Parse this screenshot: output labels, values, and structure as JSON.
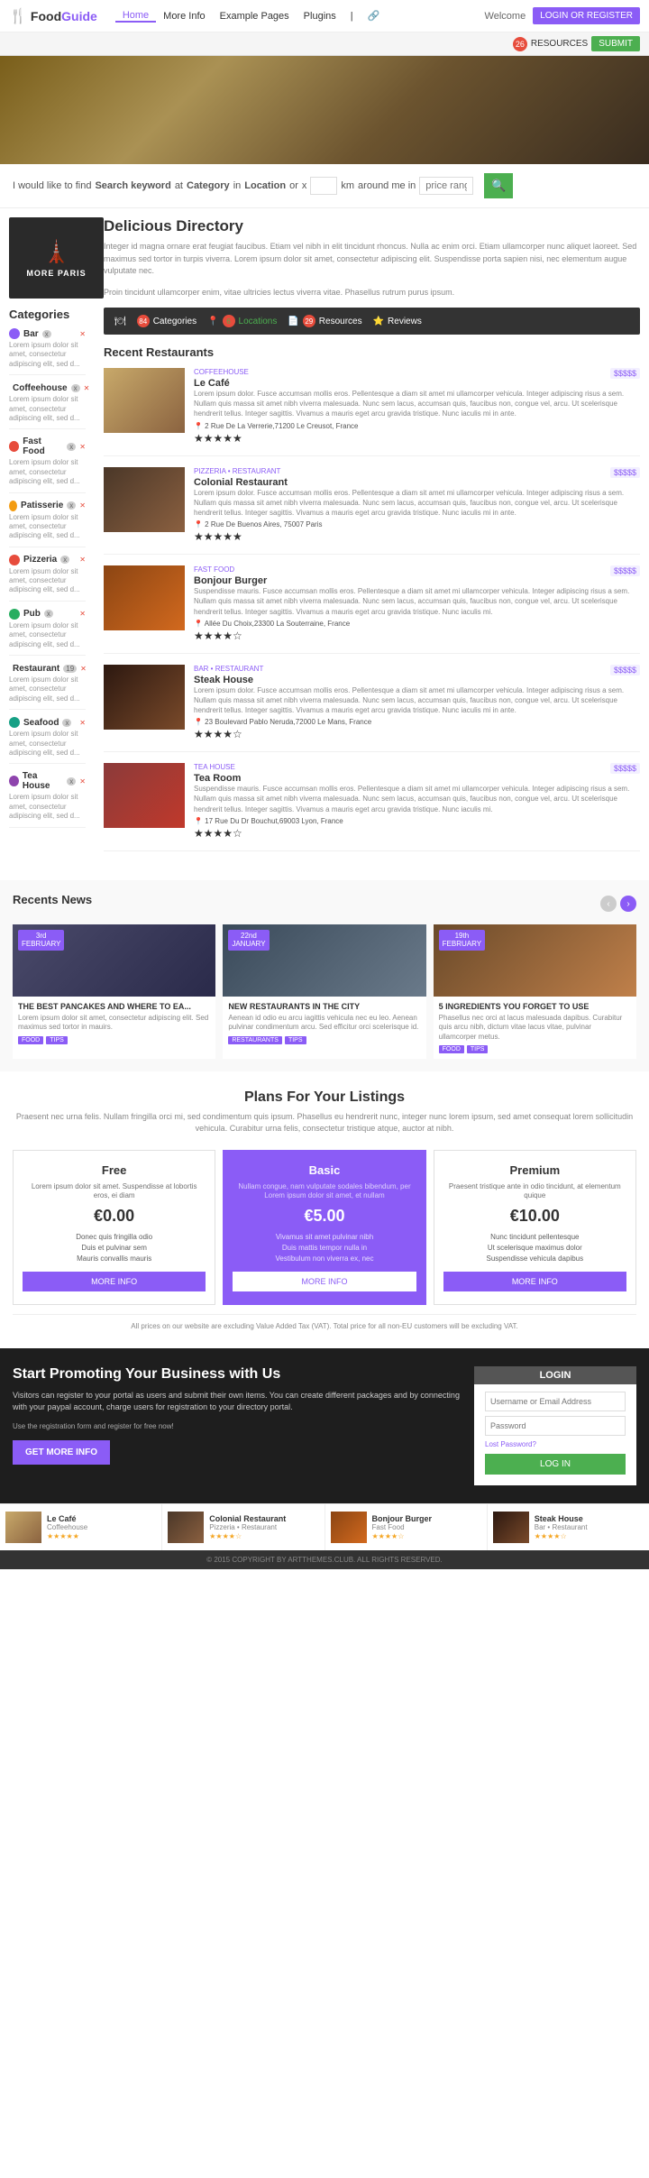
{
  "navbar": {
    "logo_icon": "🍴",
    "logo_text_plain": "Food",
    "logo_text_accent": "Guide",
    "links": [
      "Home",
      "More Info",
      "Example Pages",
      "Plugins",
      "|",
      "🔗"
    ],
    "welcome": "Welcome",
    "login_btn": "LOGIN OR REGISTER"
  },
  "topbar": {
    "badge_count": "26",
    "resources_label": "RESOURCES",
    "submit_label": "SUBMIT"
  },
  "search": {
    "prefix": "I would like to find",
    "keyword_link": "Search keyword",
    "at_label": "at",
    "category_label": "Category",
    "in_label": "in",
    "location_link": "Location",
    "or_label": "or",
    "x_label": "x",
    "km_label": "km",
    "around_me_label": "around me in",
    "price_label": "price range",
    "search_icon": "🔍"
  },
  "featured": {
    "icon": "🗼",
    "label": "MORE PARIS"
  },
  "sidebar": {
    "title": "Categories",
    "items": [
      {
        "name": "Bar",
        "count": "x",
        "color": "cat-bar",
        "desc": "Lorem ipsum dolor sit amet, consectetur adipiscing elit, sed d..."
      },
      {
        "name": "Coffeehouse",
        "count": "x",
        "color": "cat-coffee",
        "desc": "Lorem ipsum dolor sit amet, consectetur adipiscing elit, sed d..."
      },
      {
        "name": "Fast Food",
        "count": "x",
        "color": "cat-fast",
        "desc": "Lorem ipsum dolor sit amet, consectetur adipiscing elit, sed d..."
      },
      {
        "name": "Patisserie",
        "count": "x",
        "color": "cat-patisserie",
        "desc": "Lorem ipsum dolor sit amet, consectetur adipiscing elit, sed d..."
      },
      {
        "name": "Pizzeria",
        "count": "x",
        "color": "cat-pizzeria",
        "desc": "Lorem ipsum dolor sit amet, consectetur adipiscing elit, sed d..."
      },
      {
        "name": "Pub",
        "count": "x",
        "color": "cat-pub",
        "desc": "Lorem ipsum dolor sit amet, consectetur adipiscing elit, sed d..."
      },
      {
        "name": "Restaurant",
        "count": "19",
        "color": "cat-restaurant",
        "desc": "Lorem ipsum dolor sit amet, consectetur adipiscing elit, sed d..."
      },
      {
        "name": "Seafood",
        "count": "x",
        "color": "cat-seafood",
        "desc": "Lorem ipsum dolor sit amet, consectetur adipiscing elit, sed d..."
      },
      {
        "name": "Tea House",
        "count": "x",
        "color": "cat-tea",
        "desc": "Lorem ipsum dolor sit amet, consectetur adipiscing elit, sed d..."
      }
    ]
  },
  "directory": {
    "title": "Delicious Directory",
    "desc1": "Integer id magna ornare erat feugiat faucibus. Etiam vel nibh in elit tincidunt rhoncus. Nulla ac enim orci. Etiam ullamcorper nunc aliquet laoreet. Sed maximus sed tortor in turpis viverra. Lorem ipsum dolor sit amet, consectetur adipiscing elit. Suspendisse porta sapien nisi, nec elementum augue vulputate nec.",
    "desc2": "Proin tincidunt ullamcorper enim, vitae ultricies lectus viverra vitae. Phasellus rutrum purus ipsum."
  },
  "stats_bar": {
    "items": [
      {
        "icon": "🍽",
        "label": "84 Categories"
      },
      {
        "icon": "📍",
        "label": "6 Locations"
      },
      {
        "icon": "📄",
        "label": "29 Resources"
      },
      {
        "icon": "⭐",
        "label": "Reviews"
      }
    ]
  },
  "restaurants": {
    "section_title": "Recent Restaurants",
    "items": [
      {
        "name": "Le Café",
        "category": "COFFEEHOUSE",
        "price": "$$$$$",
        "desc": "Lorem ipsum dolor. Fusce accumsan mollis eros. Pellentesque a diam sit amet mi ullamcorper vehicula. Integer adipiscing risus a sem. Nullam quis massa sit amet nibh viverra malesuada. Nunc sem lacus, accumsan quis, faucibus non, congue vel, arcu. Ut scelerisque hendrerit tellus. Integer sagittis. Vivamus a mauris eget arcu gravida tristique. Nunc iaculis mi in ante.",
        "address": "2 Rue De La Verrerie,71200 Le Creusot, France",
        "img_class": "img-le-cafe",
        "stars": 5
      },
      {
        "name": "Colonial Restaurant",
        "category": "PIZZERIA • RESTAURANT",
        "price": "$$$$$",
        "desc": "Lorem ipsum dolor. Fusce accumsan mollis eros. Pellentesque a diam sit amet mi ullamcorper vehicula. Integer adipiscing risus a sem. Nullam quis massa sit amet nibh viverra malesuada. Nunc sem lacus, accumsan quis, faucibus non, congue vel, arcu. Ut scelerisque hendrerit tellus. Integer sagittis. Vivamus a mauris eget arcu gravida tristique. Nunc iaculis mi in ante.",
        "address": "2 Rue De Buenos Aires, 75007 Paris",
        "img_class": "img-colonial",
        "stars": 5
      },
      {
        "name": "Bonjour Burger",
        "category": "FAST FOOD",
        "price": "$$$$$",
        "desc": "Suspendisse mauris. Fusce accumsan mollis eros. Pellentesque a diam sit amet mi ullamcorper vehicula. Integer adipiscing risus a sem. Nullam quis massa sit amet nibh viverra malesuada. Nunc sem lacus, accumsan quis, faucibus non, congue vel, arcu. Ut scelerisque hendrerit tellus. Integer sagittis. Vivamus a mauris eget arcu gravida tristique. Nunc iaculis mi.",
        "address": "Allée Du Choix,23300 La Souterraine, France",
        "img_class": "img-burger",
        "stars": 4
      },
      {
        "name": "Steak House",
        "category": "BAR • RESTAURANT",
        "price": "$$$$$",
        "desc": "Lorem ipsum dolor. Fusce accumsan mollis eros. Pellentesque a diam sit amet mi ullamcorper vehicula. Integer adipiscing risus a sem. Nullam quis massa sit amet nibh viverra malesuada. Nunc sem lacus, accumsan quis, faucibus non, congue vel, arcu. Ut scelerisque hendrerit tellus. Integer sagittis. Vivamus a mauris eget arcu gravida tristique. Nunc iaculis mi in ante.",
        "address": "23 Boulevard Pablo Neruda,72000 Le Mans, France",
        "img_class": "img-steak",
        "stars": 4
      },
      {
        "name": "Tea Room",
        "category": "TEA HOUSE",
        "price": "$$$$$",
        "desc": "Suspendisse mauris. Fusce accumsan mollis eros. Pellentesque a diam sit amet mi ullamcorper vehicula. Integer adipiscing risus a sem. Nullam quis massa sit amet nibh viverra malesuada. Nunc sem lacus, accumsan quis, faucibus non, congue vel, arcu. Ut scelerisque hendrerit tellus. Integer sagittis. Vivamus a mauris eget arcu gravida tristique. Nunc iaculis mi.",
        "address": "17 Rue Du Dr Bouchut,69003 Lyon, France",
        "img_class": "img-tea",
        "stars": 4
      }
    ]
  },
  "news": {
    "section_title": "Recents News",
    "items": [
      {
        "date_day": "3rd",
        "date_month": "FEBRUARY",
        "title": "THE BEST PANCAKES AND WHERE TO EA...",
        "desc": "Lorem ipsum dolor sit amet, consectetur adipiscing elit. Sed maximus sed tortor in mauirs.",
        "tags": [
          "FOOD",
          "TIPS"
        ],
        "img_class": "img-news1"
      },
      {
        "date_day": "22nd",
        "date_month": "JANUARY",
        "title": "NEW RESTAURANTS IN THE CITY",
        "desc": "Aenean id odio eu arcu iagittis vehicula nec eu leo. Aenean pulvinar condimentum arcu. Sed efficitur orci scelerisque id. Duis aliquet vitae ipsum viae.",
        "tags": [
          "RESTAURANTS",
          "TIPS"
        ],
        "img_class": "img-news2"
      },
      {
        "date_day": "19th",
        "date_month": "FEBRUARY",
        "title": "5 INGREDIENTS YOU FORGET TO USE",
        "desc": "Phasellus nec orci at lacus malesuada dapibus. Curabitur quis arcu nibh, dictum vitae lacus vitae, pulvinar ullamcorper metus. Praesent efficitur.",
        "tags": [
          "FOOD",
          "TIPS"
        ],
        "img_class": "img-news3"
      }
    ]
  },
  "plans": {
    "section_title": "Plans For Your Listings",
    "desc": "Praesent nec urna felis. Nullam fringilla orci mi, sed condimentum quis ipsum. Phasellus eu hendrerit nunc, integer nunc lorem ipsum, sed amet consequat lorem sollicitudin vehicula. Curabitur urna felis, consectetur tristique atque, auctor at nibh.",
    "items": [
      {
        "name": "Free",
        "desc": "Lorem ipsum dolor sit amet. Suspendisse at lobortis eros, ei diam",
        "price": "€0.00",
        "features": [
          "Donec quis fringilla odio",
          "Duis et pulvinar sem",
          "Mauris convallis mauris"
        ],
        "btn": "MORE INFO",
        "featured": false
      },
      {
        "name": "Basic",
        "desc": "Nullam congue, nam vulputate sodales bibendum, per Lorem ipsum dolor sit amet, et nullam",
        "price": "€5.00",
        "features": [
          "Vivamus sit amet pulvinar nibh",
          "Duis mattis tempor nulla in",
          "Vestibulum non viverra ex, nec"
        ],
        "btn": "MORE INFO",
        "featured": true
      },
      {
        "name": "Premium",
        "desc": "Praesent tristique ante in odio tincidunt, at elementum quique",
        "price": "€10.00",
        "features": [
          "Nunc tincidunt pellentesque",
          "Ut scelerisque maximus dolor",
          "Suspendisse vehicula dapibus"
        ],
        "btn": "MORE INFO",
        "featured": false
      }
    ],
    "vat_note": "All prices on our website are excluding Value Added Tax (VAT). Total price for all non-EU customers will be excluding VAT."
  },
  "promote": {
    "title": "Start Promoting Your Business with Us",
    "desc": "Visitors can register to your portal as users and submit their own items. You can create different packages and by connecting with your paypal account, charge users for registration to your directory portal.",
    "note": "Use the registration form and register for free now!",
    "btn": "GET MORE INFO"
  },
  "login_box": {
    "title": "LOGIN",
    "username_placeholder": "Username or Email Address",
    "password_placeholder": "Password",
    "forgot_label": "Lost Password?",
    "login_btn": "LOG IN"
  },
  "footer_cards": [
    {
      "name": "Le Café",
      "cat": "Coffeehouse",
      "stars": 5,
      "img_class": "img-le-cafe"
    },
    {
      "name": "Colonial Restaurant",
      "cat": "Pizzeria • Restaurant",
      "stars": 4,
      "img_class": "img-colonial"
    },
    {
      "name": "Bonjour Burger",
      "cat": "Fast Food",
      "stars": 4,
      "img_class": "img-burger"
    },
    {
      "name": "Steak House",
      "cat": "Bar • Restaurant",
      "stars": 4,
      "img_class": "img-steak"
    }
  ],
  "copyright": "© 2015 COPYRIGHT BY ARTTHEMES.CLUB. ALL RIGHTS RESERVED."
}
